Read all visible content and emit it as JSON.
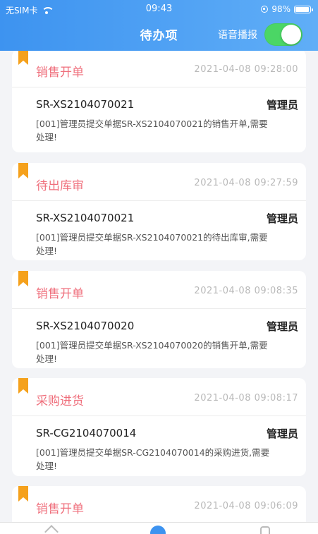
{
  "status_bar": {
    "carrier": "无SIM卡",
    "time": "09:43",
    "battery": "98%"
  },
  "header": {
    "title": "待办项",
    "voice_label": "语音播报",
    "voice_on": true
  },
  "tasks": [
    {
      "title": "销售开单",
      "time": "2021-04-08 09:28:00",
      "doc_no": "SR-XS2104070021",
      "user": "管理员",
      "desc": "[001]管理员提交单据SR-XS2104070021的销售开单,需要处理!"
    },
    {
      "title": "待出库审",
      "time": "2021-04-08 09:27:59",
      "doc_no": "SR-XS2104070021",
      "user": "管理员",
      "desc": "[001]管理员提交单据SR-XS2104070021的待出库审,需要处理!"
    },
    {
      "title": "销售开单",
      "time": "2021-04-08 09:08:35",
      "doc_no": "SR-XS2104070020",
      "user": "管理员",
      "desc": "[001]管理员提交单据SR-XS2104070020的销售开单,需要处理!"
    },
    {
      "title": "采购进货",
      "time": "2021-04-08 09:08:17",
      "doc_no": "SR-CG2104070014",
      "user": "管理员",
      "desc": "[001]管理员提交单据SR-CG2104070014的采购进货,需要处理!"
    },
    {
      "title": "销售开单",
      "time": "2021-04-08 09:06:09"
    }
  ],
  "colors": {
    "header": "#3d93f0",
    "title": "#ef6f7c",
    "bookmark": "#f5a11c",
    "toggle_on": "#4bd665"
  }
}
